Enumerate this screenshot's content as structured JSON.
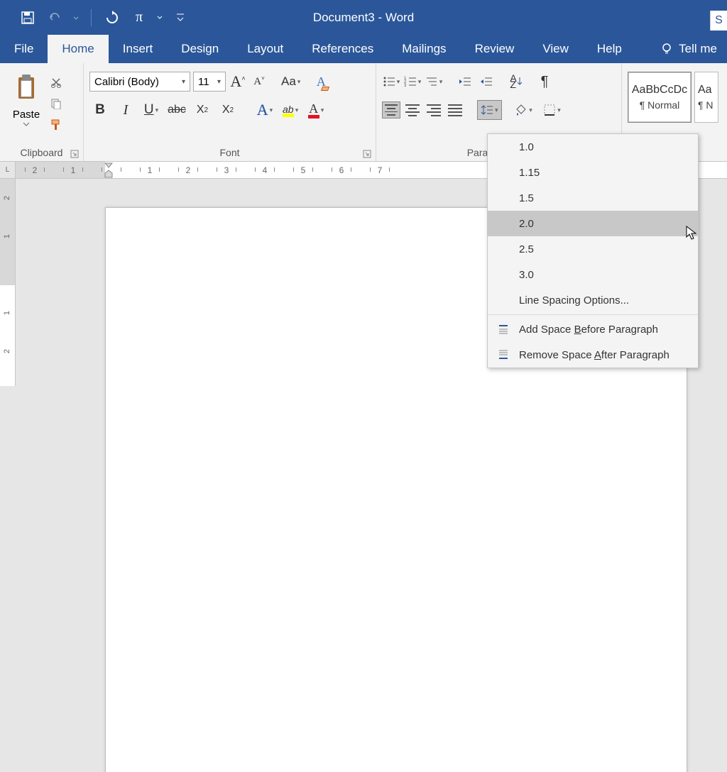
{
  "title": "Document3  -  Word",
  "share_label": "S",
  "tabs": {
    "file": "File",
    "home": "Home",
    "insert": "Insert",
    "design": "Design",
    "layout": "Layout",
    "references": "References",
    "mailings": "Mailings",
    "review": "Review",
    "view": "View",
    "help": "Help",
    "tellme": "Tell me"
  },
  "groups": {
    "clipboard": {
      "label": "Clipboard",
      "paste": "Paste"
    },
    "font": {
      "label": "Font",
      "name": "Calibri (Body)",
      "size": "11",
      "aa": "Aa",
      "abc": "abc",
      "x2sub": "X",
      "sub2": "2",
      "x2sup": "X",
      "sup2": "2",
      "ab_hilite": "ab"
    },
    "paragraph": {
      "label": "Para"
    },
    "styles": {
      "preview1": "AaBbCcDc",
      "name1": "¶ Normal",
      "preview2": "Aa",
      "name2": "¶ N"
    }
  },
  "ruler": {
    "labels": [
      "2",
      "1",
      "",
      "1",
      "2",
      "3",
      "4",
      "5",
      "6",
      "7"
    ]
  },
  "vruler": {
    "labels": [
      "2",
      "1",
      "",
      "1",
      "2"
    ]
  },
  "linespacing_menu": {
    "items": [
      "1.0",
      "1.15",
      "1.5",
      "2.0",
      "2.5",
      "3.0"
    ],
    "options": "Line Spacing Options...",
    "add_before_pre": "Add Space ",
    "add_before_accel": "B",
    "add_before_post": "efore Paragraph",
    "remove_after_pre": "Remove Space ",
    "remove_after_accel": "A",
    "remove_after_post": "fter Paragraph"
  }
}
